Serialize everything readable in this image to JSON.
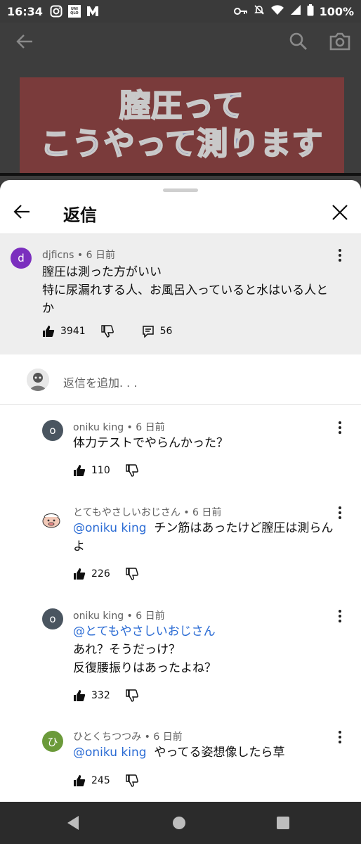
{
  "status_bar": {
    "time": "16:34",
    "uniqlo_top": "UNI",
    "uniqlo_bottom": "QLO",
    "battery": "100%",
    "icons": [
      "instagram-icon",
      "uniqlo-icon",
      "m-app-icon",
      "key-icon",
      "mute-icon",
      "wifi-icon",
      "signal-icon",
      "battery-icon"
    ]
  },
  "video": {
    "banner_line1": "膣圧って",
    "banner_line2": "こうやって測ります",
    "icons": [
      "back-arrow-icon",
      "search-icon",
      "camera-icon"
    ],
    "banner_color": "#7a3b3b"
  },
  "sheet": {
    "title": "返信",
    "icons": [
      "back-arrow-icon",
      "close-icon"
    ]
  },
  "parent_comment": {
    "avatar_letter": "d",
    "avatar_color": "#7b2fbe",
    "author": "djficns",
    "time": "• 6 日前",
    "line1": "膣圧は測った方がいい",
    "line2": "特に尿漏れする人、お風呂入っていると水はいる人と",
    "line3": "か",
    "likes": "3941",
    "replies": "56"
  },
  "add_reply": {
    "placeholder": "返信を追加. . ."
  },
  "replies": [
    {
      "avatar_letter": "o",
      "avatar_color": "#4a5560",
      "author": "oniku king",
      "time": "• 6 日前",
      "line1": "体力テストでやらんかった？",
      "likes": "110"
    },
    {
      "avatar_letter": "",
      "avatar_color": "#ffffff",
      "author": "とてもやさしいおじさん",
      "time": "• 6 日前",
      "mention": "@oniku king",
      "line1": "チン筋はあったけど膣圧は測らん",
      "line2": "よ",
      "likes": "226"
    },
    {
      "avatar_letter": "o",
      "avatar_color": "#4a5560",
      "author": "oniku king",
      "time": "• 6 日前",
      "mention": "@とてもやさしいおじさん",
      "line1": "あれ？そうだっけ？",
      "line2": "反復腰振りはあったよね？",
      "likes": "332"
    },
    {
      "avatar_letter": "ひ",
      "avatar_color": "#6b9a3a",
      "author": "ひとくちつつみ",
      "time": "• 6 日前",
      "mention": "@oniku king",
      "line1": "やってる姿想像したら草",
      "likes": "245"
    }
  ],
  "colors": {
    "mention": "#2a6bd4",
    "meta_text": "#606060",
    "parent_bg": "#eeeeee"
  }
}
